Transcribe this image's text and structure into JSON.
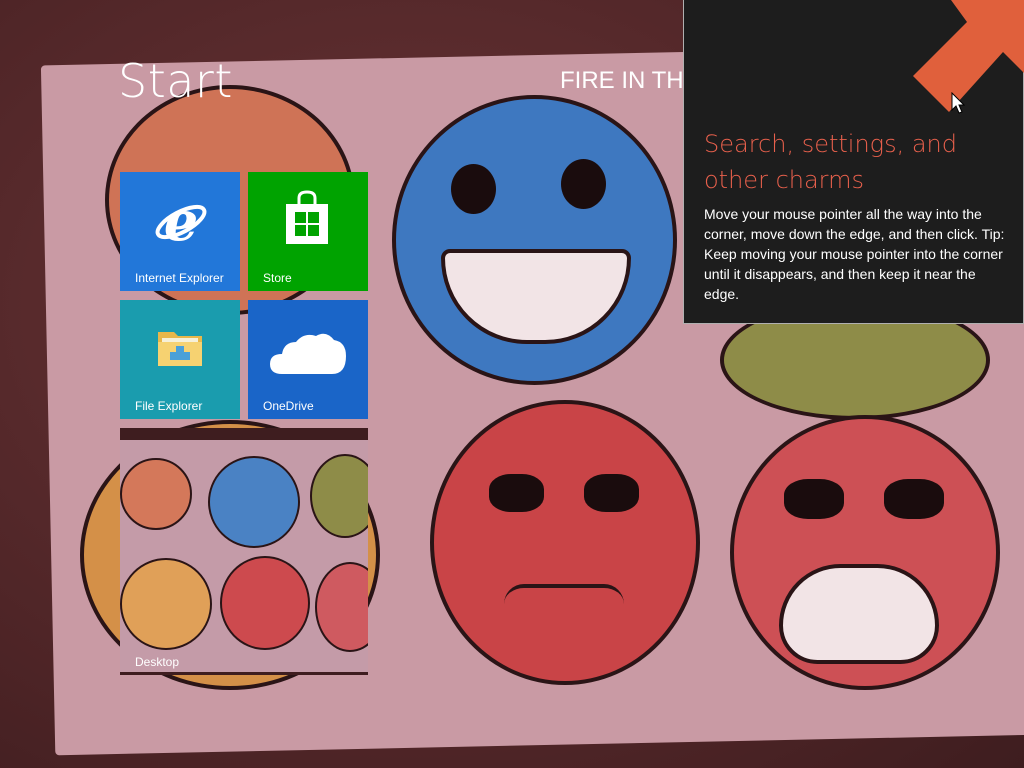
{
  "screen": {
    "title": "Start",
    "user_header": "FIRE IN TH"
  },
  "tiles": [
    {
      "label": "Internet Explorer",
      "icon": "internet-explorer-icon",
      "color": "#2277d9"
    },
    {
      "label": "Store",
      "icon": "store-icon",
      "color": "#00a300"
    },
    {
      "label": "File Explorer",
      "icon": "file-explorer-icon",
      "color": "#1a9cae"
    },
    {
      "label": "OneDrive",
      "icon": "onedrive-icon",
      "color": "#1a65c8"
    },
    {
      "label": "Desktop",
      "icon": "desktop-thumbnail",
      "color": "#c49ba8"
    }
  ],
  "charms_tip": {
    "title": "Search, settings, and other charms",
    "body": "Move your mouse pointer all the way into the corner, move down the edge, and then click. Tip: Keep moving your mouse pointer into the corner until it disappears, and then keep it near the edge.",
    "arrow_icon": "diagonal-arrow-icon",
    "accent_color": "#e8604c",
    "panel_color": "#1d1d1d"
  }
}
